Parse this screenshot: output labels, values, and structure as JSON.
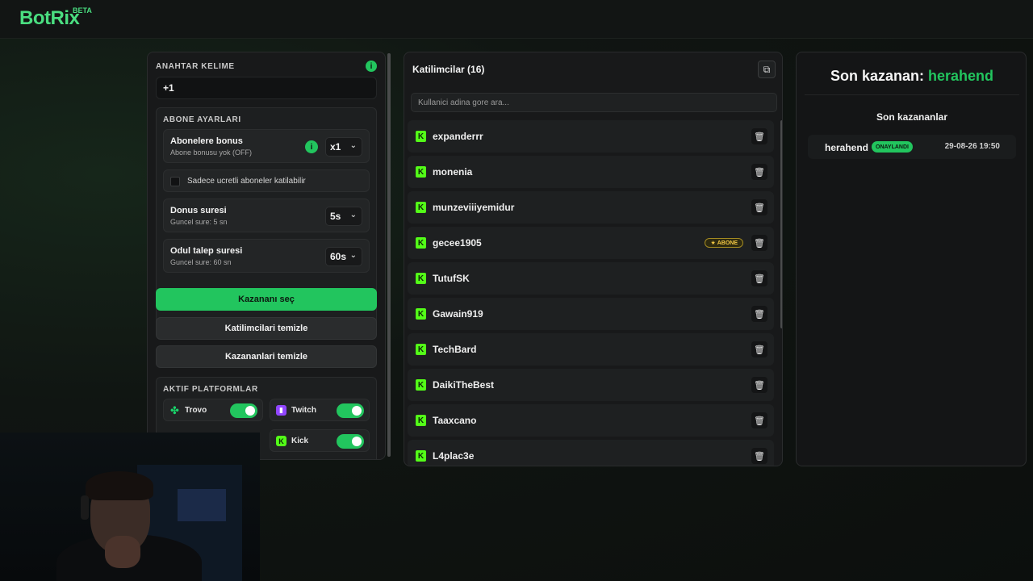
{
  "app": {
    "logo": "BotRix",
    "beta": "BETA"
  },
  "left_panel": {
    "keyword_label": "ANAHTAR KELIME",
    "keyword_value": "+1",
    "info_glyph": "i",
    "subscriber_settings": {
      "label": "ABONE AYARLARI",
      "bonus_title": "Abonelere bonus",
      "bonus_sub": "Abone bonusu yok (OFF)",
      "bonus_value": "x1",
      "paid_only_label": "Sadece ucretli aboneler katilabilir",
      "paid_only_checked": false,
      "delay_title": "Donus suresi",
      "delay_sub": "Guncel sure: 5 sn",
      "delay_value": "5s",
      "claim_title": "Odul talep suresi",
      "claim_sub": "Guncel sure: 60 sn",
      "claim_value": "60s"
    },
    "buttons": {
      "pick_winner": "Kazananı seç",
      "clear_participants": "Katilimcilari temizle",
      "clear_winners": "Kazananlari temizle"
    },
    "platforms_label": "AKTIF PLATFORMLAR",
    "platforms": [
      {
        "name": "Trovo",
        "icon": "trovo-icon",
        "enabled": true,
        "color": "#19d66b"
      },
      {
        "name": "Twitch",
        "icon": "twitch-icon",
        "enabled": true,
        "color": "#9146ff"
      },
      {
        "name": "Kick",
        "icon": "kick-icon",
        "enabled": true,
        "color": "#53fc18"
      }
    ]
  },
  "participants": {
    "title": "Katilimcilar (16)",
    "search_placeholder": "Kullanici adina gore ara...",
    "items": [
      {
        "name": "expanderrr",
        "platform": "kick",
        "subscriber": false
      },
      {
        "name": "monenia",
        "platform": "kick",
        "subscriber": false
      },
      {
        "name": "munzeviiiyemidur",
        "platform": "kick",
        "subscriber": false
      },
      {
        "name": "gecee1905",
        "platform": "kick",
        "subscriber": true,
        "badge": "ABONE"
      },
      {
        "name": "TutufSK",
        "platform": "kick",
        "subscriber": false
      },
      {
        "name": "Gawain919",
        "platform": "kick",
        "subscriber": false
      },
      {
        "name": "TechBard",
        "platform": "kick",
        "subscriber": false
      },
      {
        "name": "DaikiTheBest",
        "platform": "kick",
        "subscriber": false
      },
      {
        "name": "Taaxcano",
        "platform": "kick",
        "subscriber": false
      },
      {
        "name": "L4plac3e",
        "platform": "kick",
        "subscriber": false
      }
    ]
  },
  "winners": {
    "last_winner_label": "Son kazanan:",
    "last_winner_name": "herahend",
    "list_title": "Son kazananlar",
    "rows": [
      {
        "name": "herahend",
        "status": "ONAYLANDI",
        "date": "29-08-26 19:50"
      }
    ]
  },
  "colors": {
    "accent": "#22c55e",
    "kick": "#53fc18",
    "subscriber_badge": "#f2c744"
  }
}
